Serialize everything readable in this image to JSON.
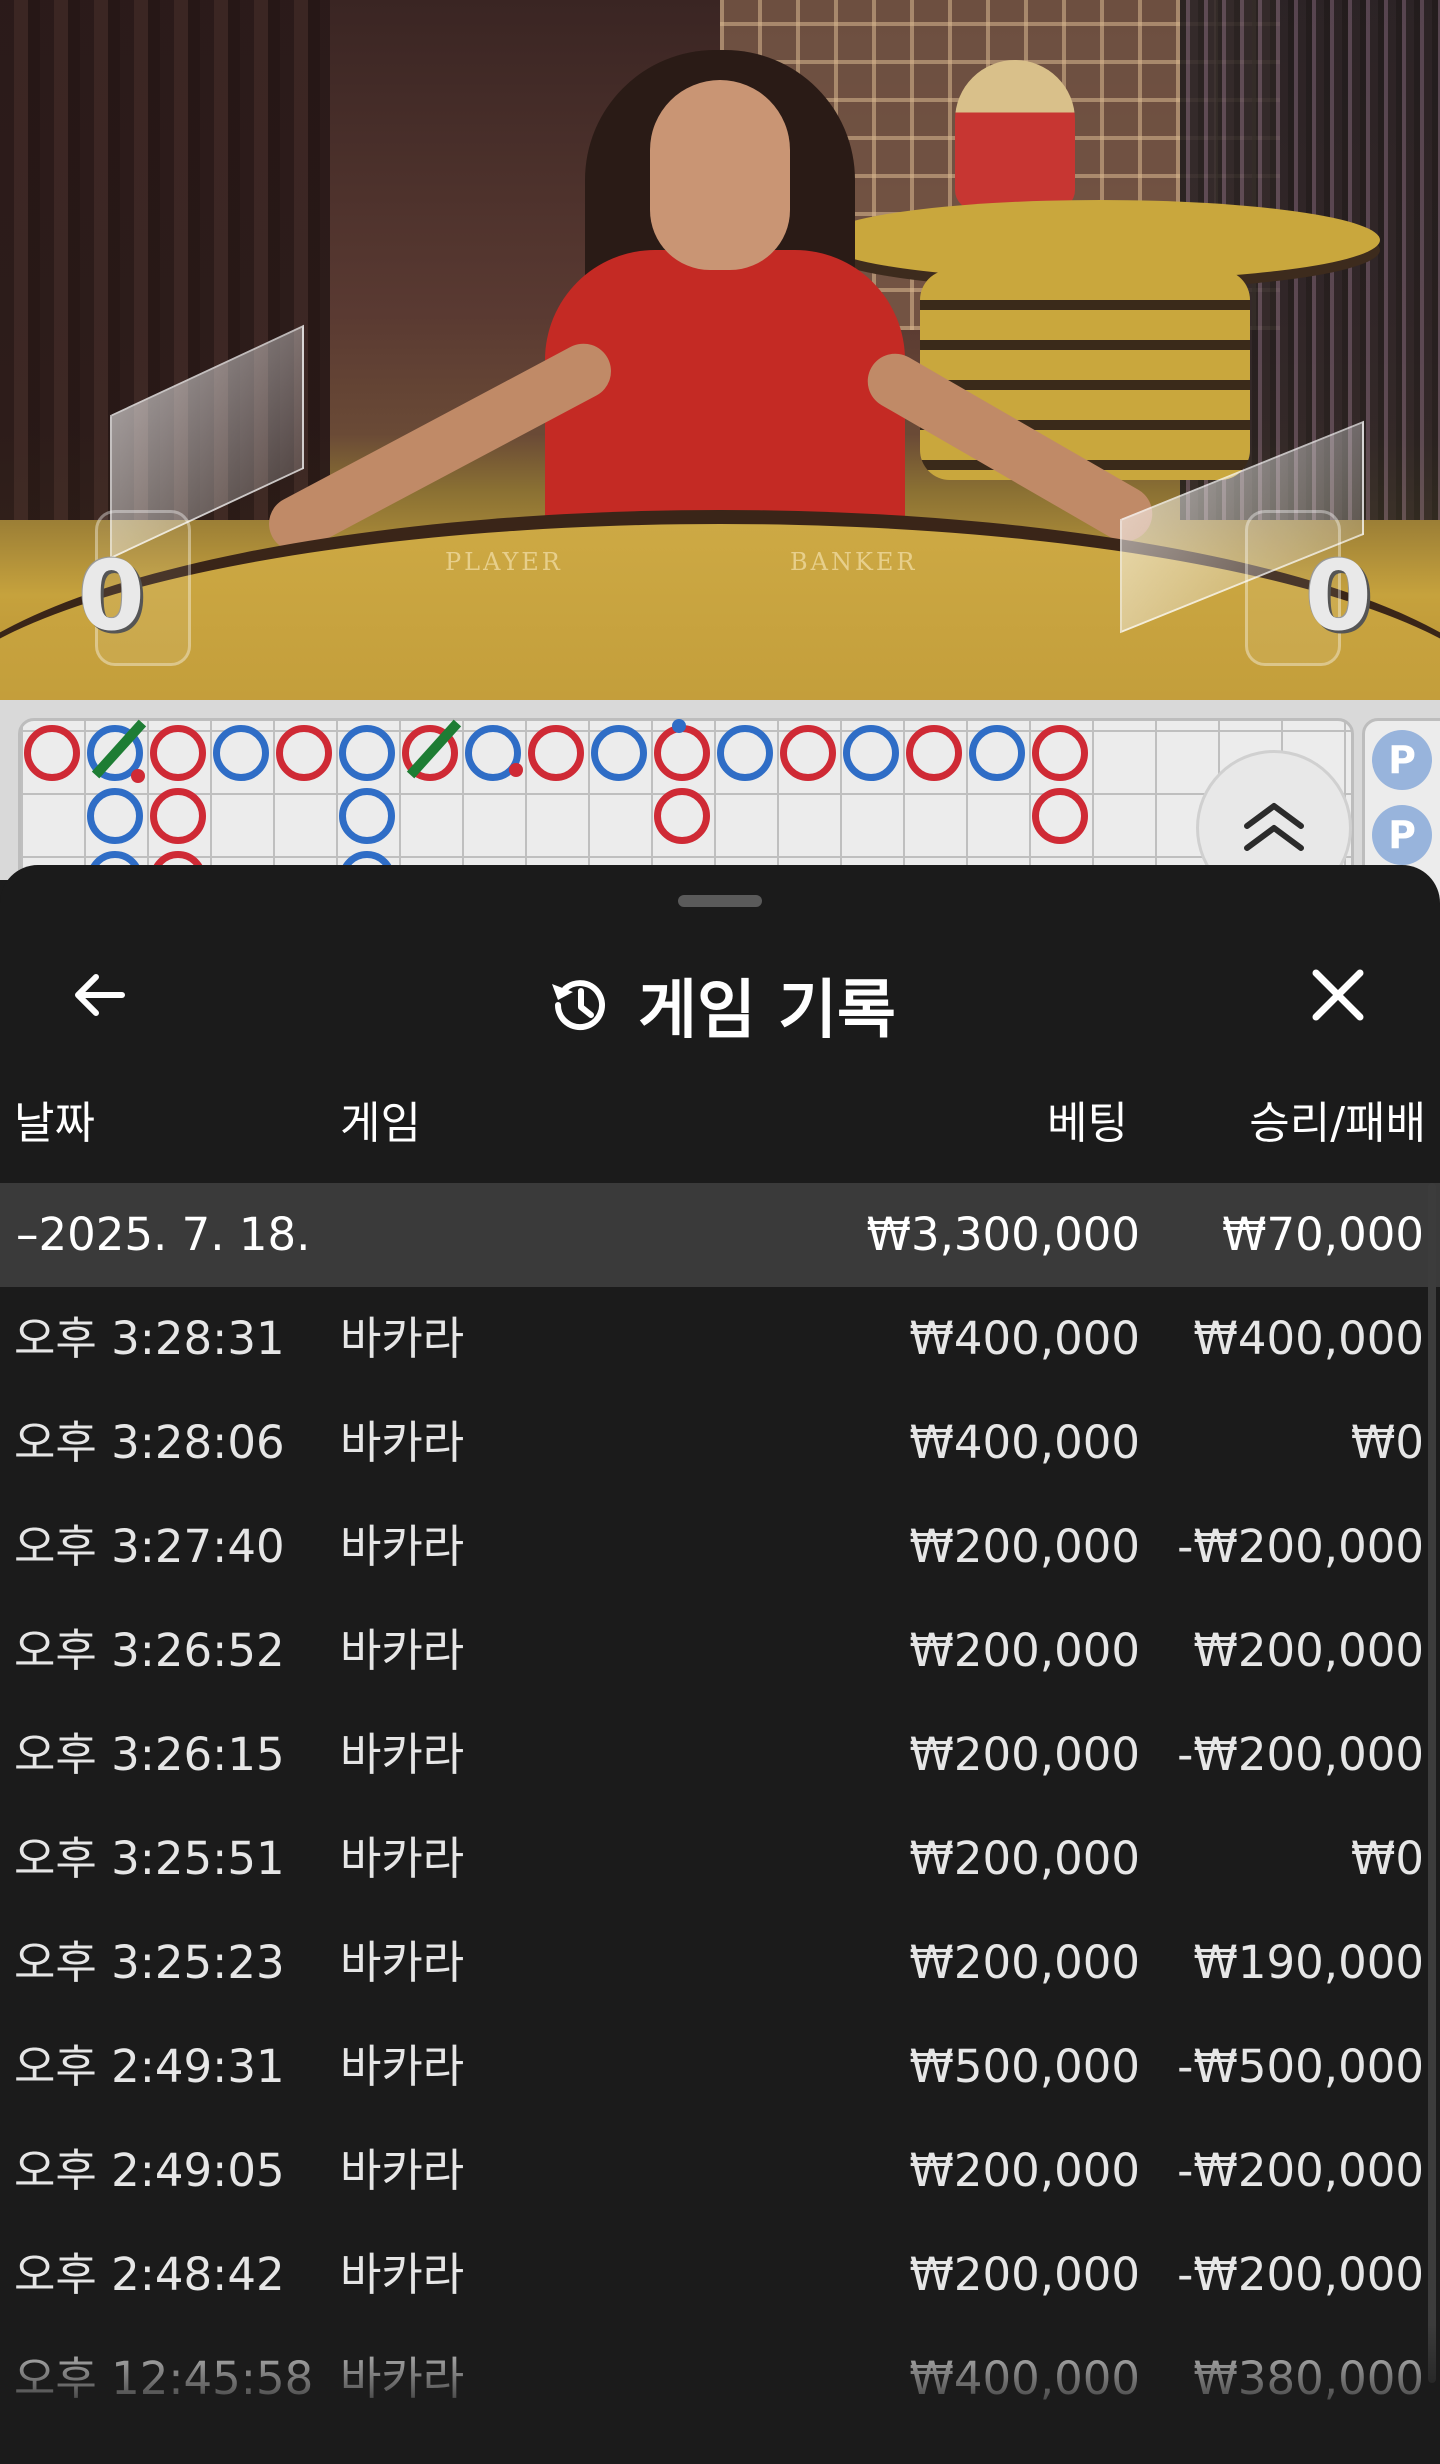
{
  "video": {
    "player_label": "PLAYER",
    "banker_label": "BANKER",
    "player_score": "0",
    "banker_score": "0"
  },
  "roadmap": {
    "side_beads": [
      "P",
      "P"
    ]
  },
  "sheet": {
    "title": "게임 기록",
    "icons": {
      "back": "arrow-left-icon",
      "history": "history-icon",
      "close": "close-icon",
      "expand": "chevron-double-up-icon"
    }
  },
  "columns": {
    "date": "날짜",
    "game": "게임",
    "bet": "베팅",
    "win_loss": "승리/패배"
  },
  "date_group": {
    "date": "–2025. 7. 18.",
    "total_bet": "₩3,300,000",
    "total_win_loss": "₩70,000"
  },
  "rows": [
    {
      "time": "오후 3:28:31",
      "game": "바카라",
      "bet": "₩400,000",
      "win_loss": "₩400,000"
    },
    {
      "time": "오후 3:28:06",
      "game": "바카라",
      "bet": "₩400,000",
      "win_loss": "₩0"
    },
    {
      "time": "오후 3:27:40",
      "game": "바카라",
      "bet": "₩200,000",
      "win_loss": "-₩200,000"
    },
    {
      "time": "오후 3:26:52",
      "game": "바카라",
      "bet": "₩200,000",
      "win_loss": "₩200,000"
    },
    {
      "time": "오후 3:26:15",
      "game": "바카라",
      "bet": "₩200,000",
      "win_loss": "-₩200,000"
    },
    {
      "time": "오후 3:25:51",
      "game": "바카라",
      "bet": "₩200,000",
      "win_loss": "₩0"
    },
    {
      "time": "오후 3:25:23",
      "game": "바카라",
      "bet": "₩200,000",
      "win_loss": "₩190,000"
    },
    {
      "time": "오후 2:49:31",
      "game": "바카라",
      "bet": "₩500,000",
      "win_loss": "-₩500,000"
    },
    {
      "time": "오후 2:49:05",
      "game": "바카라",
      "bet": "₩200,000",
      "win_loss": "-₩200,000"
    },
    {
      "time": "오후 2:48:42",
      "game": "바카라",
      "bet": "₩200,000",
      "win_loss": "-₩200,000"
    },
    {
      "time": "오후 12:45:58",
      "game": "바카라",
      "bet": "₩400,000",
      "win_loss": "₩380,000"
    }
  ]
}
